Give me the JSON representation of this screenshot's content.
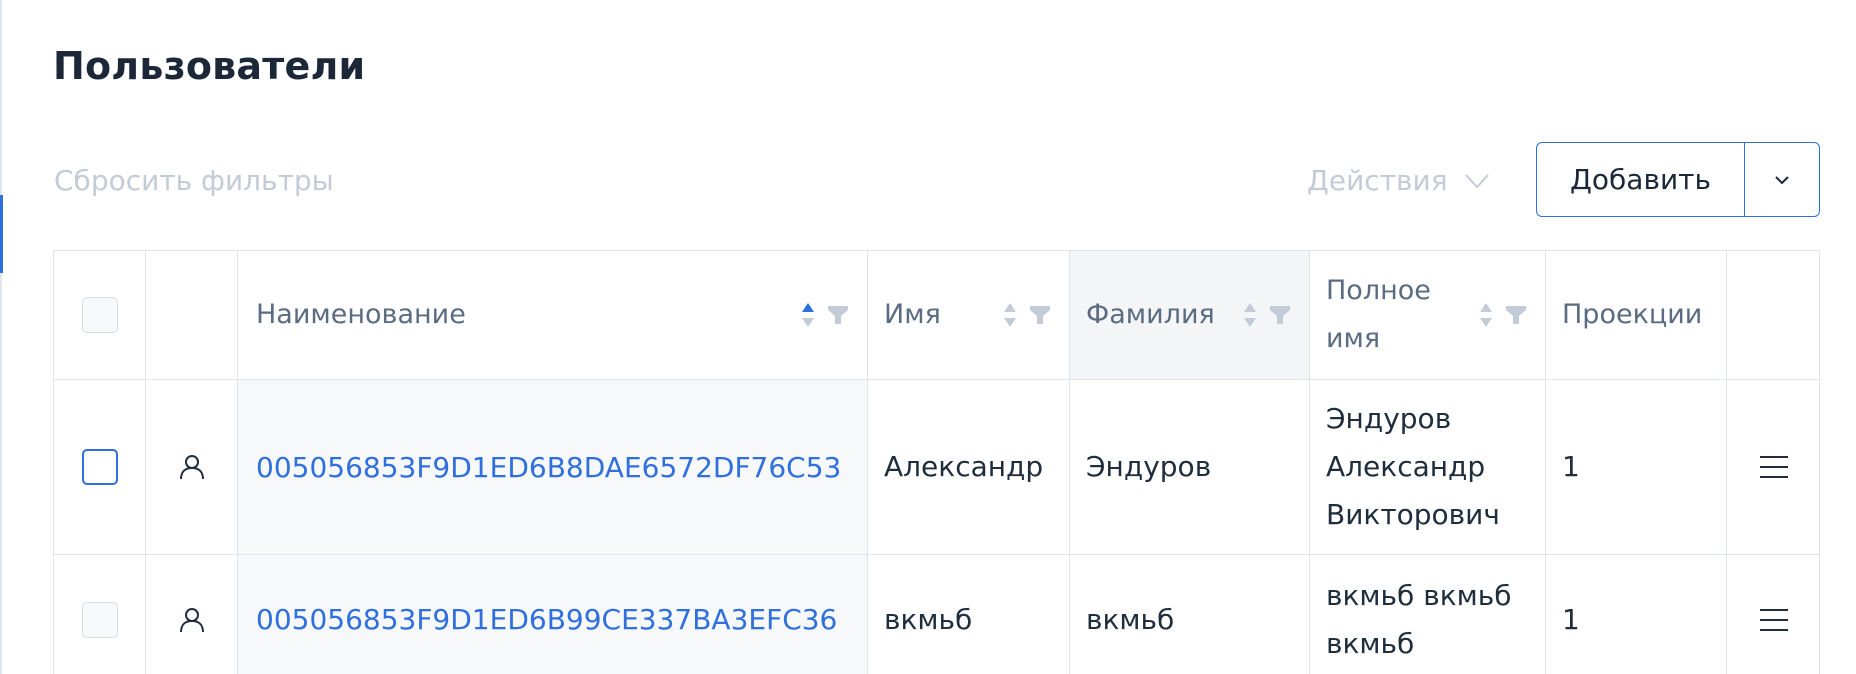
{
  "page": {
    "title": "Пользователи"
  },
  "toolbar": {
    "reset_filters": "Сбросить фильтры",
    "actions": "Действия",
    "add": "Добавить"
  },
  "table": {
    "columns": [
      "Наименование",
      "Имя",
      "Фамилия",
      "Полное имя",
      "Проекции"
    ],
    "sorted_column": "Наименование",
    "rows": [
      {
        "name": "005056853F9D1ED6B8DAE6572DF76C53",
        "first_name": "Александр",
        "last_name": "Эндуров",
        "full_name": "Эндуров Александр Викторович",
        "projections": "1"
      },
      {
        "name": "005056853F9D1ED6B99CE337BA3EFC36",
        "first_name": "вкмьб",
        "last_name": "вкмьб",
        "full_name": "вкмьб вкмьб вкмьб",
        "projections": "1"
      }
    ]
  },
  "colors": {
    "accent": "#2f6fde",
    "muted": "#c3cbd6",
    "header_text": "#5b6b82",
    "border": "#dfe4ec"
  }
}
